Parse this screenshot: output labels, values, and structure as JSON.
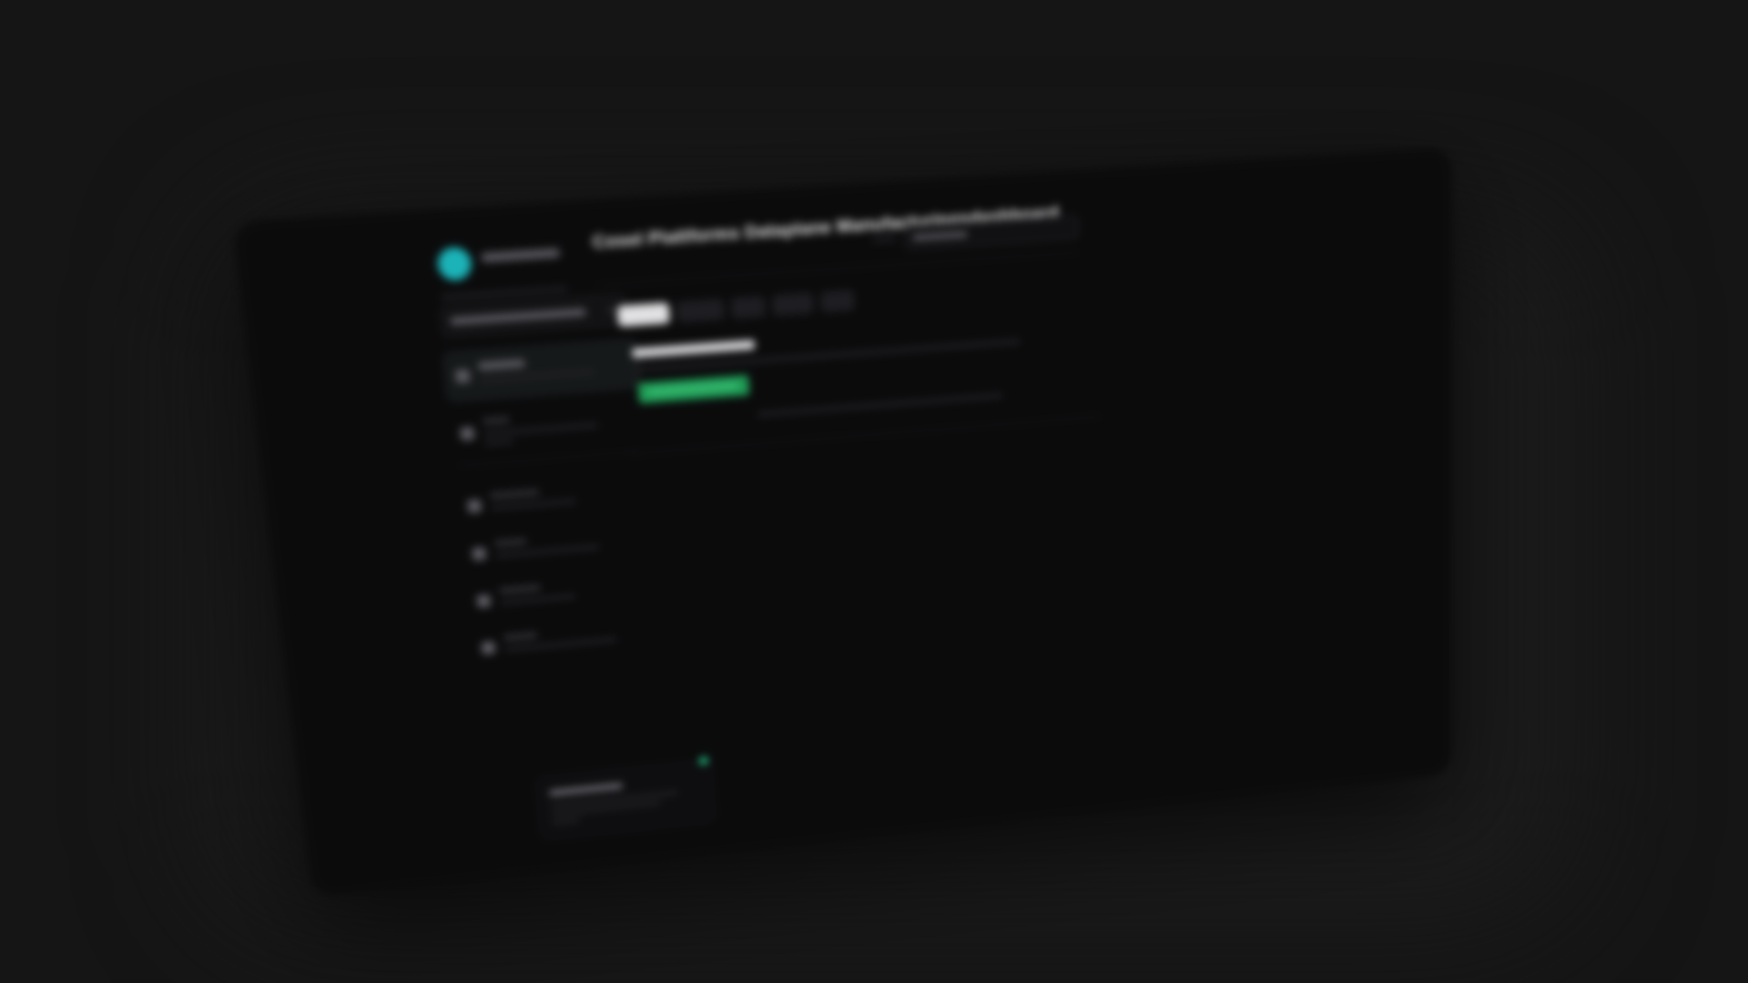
{
  "window": {
    "title": "Cosel Plattforms Dataplane Manufacturingsdashboard"
  },
  "colors": {
    "page_background": "#151515",
    "window_background": "#0b0b0c",
    "accent_teal": "#1bb3b8",
    "accent_green": "#1f9a55",
    "status_dot": "#1fb07a"
  },
  "sidebar": {
    "logo_icon": "logo-dot-icon",
    "workspace_select_icon": "chevron-down-icon",
    "nav_item_icons": [
      "grid-icon",
      "doc-icon",
      "flag-icon",
      "box-icon",
      "check-icon",
      "user-icon"
    ],
    "active_nav_index": 0
  },
  "main": {
    "active_tab_index": 0,
    "tab_count": 5
  }
}
